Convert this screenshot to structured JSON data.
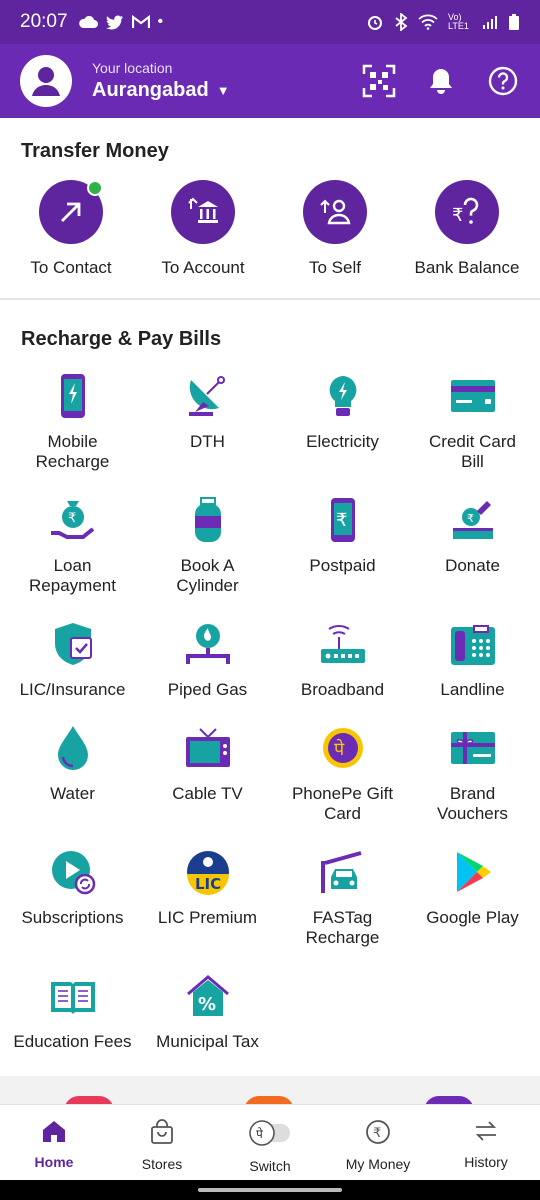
{
  "status": {
    "time": "20:07",
    "network": "Vo) LTE1"
  },
  "header": {
    "location_label": "Your location",
    "city": "Aurangabad"
  },
  "transfer": {
    "title": "Transfer Money",
    "items": [
      {
        "label": "To Contact",
        "icon": "arrow-up-right-icon"
      },
      {
        "label": "To Account",
        "icon": "bank-icon"
      },
      {
        "label": "To Self",
        "icon": "self-transfer-icon"
      },
      {
        "label": "Bank Balance",
        "icon": "rupee-question-icon"
      }
    ]
  },
  "recharge": {
    "title": "Recharge & Pay Bills",
    "items": [
      {
        "label": "Mobile Recharge",
        "icon": "mobile-icon"
      },
      {
        "label": "DTH",
        "icon": "satellite-dish-icon"
      },
      {
        "label": "Electricity",
        "icon": "bulb-icon"
      },
      {
        "label": "Credit Card Bill",
        "icon": "credit-card-icon"
      },
      {
        "label": "Loan Repayment",
        "icon": "loan-icon"
      },
      {
        "label": "Book A Cylinder",
        "icon": "cylinder-icon"
      },
      {
        "label": "Postpaid",
        "icon": "postpaid-icon"
      },
      {
        "label": "Donate",
        "icon": "donate-icon"
      },
      {
        "label": "LIC/Insurance",
        "icon": "shield-icon"
      },
      {
        "label": "Piped Gas",
        "icon": "piped-gas-icon"
      },
      {
        "label": "Broadband",
        "icon": "router-icon"
      },
      {
        "label": "Landline",
        "icon": "landline-icon"
      },
      {
        "label": "Water",
        "icon": "water-drop-icon"
      },
      {
        "label": "Cable TV",
        "icon": "tv-icon"
      },
      {
        "label": "PhonePe Gift Card",
        "icon": "gift-card-icon"
      },
      {
        "label": "Brand Vouchers",
        "icon": "voucher-icon"
      },
      {
        "label": "Subscriptions",
        "icon": "play-refresh-icon"
      },
      {
        "label": "LIC Premium",
        "icon": "lic-icon"
      },
      {
        "label": "FASTag Recharge",
        "icon": "fastag-car-icon"
      },
      {
        "label": "Google Play",
        "icon": "google-play-icon"
      },
      {
        "label": "Education Fees",
        "icon": "book-icon"
      },
      {
        "label": "Municipal Tax",
        "icon": "house-percent-icon"
      }
    ]
  },
  "nav": {
    "items": [
      {
        "label": "Home",
        "icon": "home-icon"
      },
      {
        "label": "Stores",
        "icon": "bag-icon"
      },
      {
        "label": "Switch",
        "icon": "switch-toggle-icon"
      },
      {
        "label": "My Money",
        "icon": "rupee-circle-icon"
      },
      {
        "label": "History",
        "icon": "history-arrows-icon"
      }
    ]
  },
  "colors": {
    "brand": "#5f259f",
    "header": "#6a2ab4",
    "teal": "#18a3a3",
    "purple_icon": "#6b2bb5"
  }
}
